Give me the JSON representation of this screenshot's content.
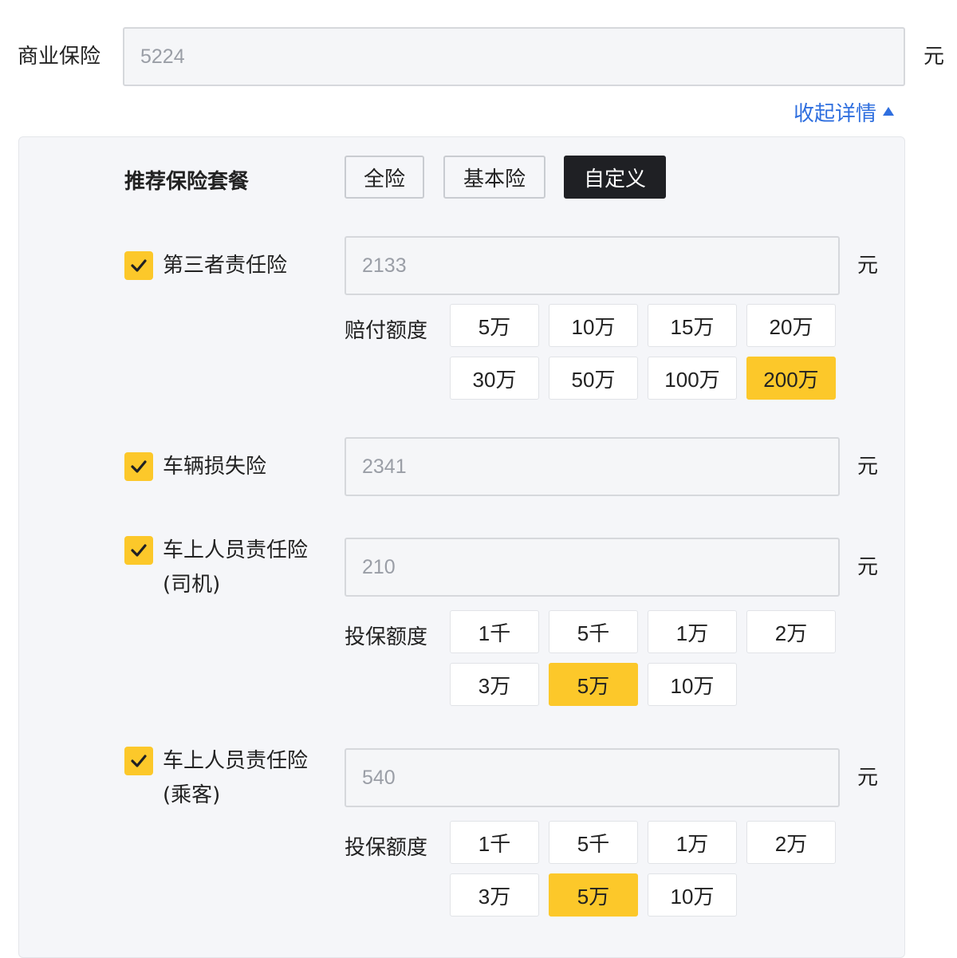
{
  "commercial": {
    "label": "商业保险",
    "value": "5224",
    "unit": "元"
  },
  "collapse": {
    "label": "收起详情"
  },
  "packages": {
    "title": "推荐保险套餐",
    "options": [
      "全险",
      "基本险",
      "自定义"
    ],
    "selected": "自定义"
  },
  "items": [
    {
      "name": "第三者责任险",
      "name_line2": "",
      "checked": true,
      "value": "2133",
      "unit": "元",
      "sub_label": "赔付额度",
      "options": [
        "5万",
        "10万",
        "15万",
        "20万",
        "30万",
        "50万",
        "100万",
        "200万"
      ],
      "selected": "200万"
    },
    {
      "name": "车辆损失险",
      "name_line2": "",
      "checked": true,
      "value": "2341",
      "unit": "元",
      "sub_label": "",
      "options": [],
      "selected": ""
    },
    {
      "name": "车上人员责任险",
      "name_line2": "(司机)",
      "checked": true,
      "value": "210",
      "unit": "元",
      "sub_label": "投保额度",
      "options": [
        "1千",
        "5千",
        "1万",
        "2万",
        "3万",
        "5万",
        "10万"
      ],
      "selected": "5万"
    },
    {
      "name": "车上人员责任险",
      "name_line2": "(乘客)",
      "checked": true,
      "value": "540",
      "unit": "元",
      "sub_label": "投保额度",
      "options": [
        "1千",
        "5千",
        "1万",
        "2万",
        "3万",
        "5万",
        "10万"
      ],
      "selected": "5万"
    }
  ],
  "colors": {
    "accent": "#fcc82a",
    "link": "#2f6fdf",
    "dark": "#1f2024"
  }
}
